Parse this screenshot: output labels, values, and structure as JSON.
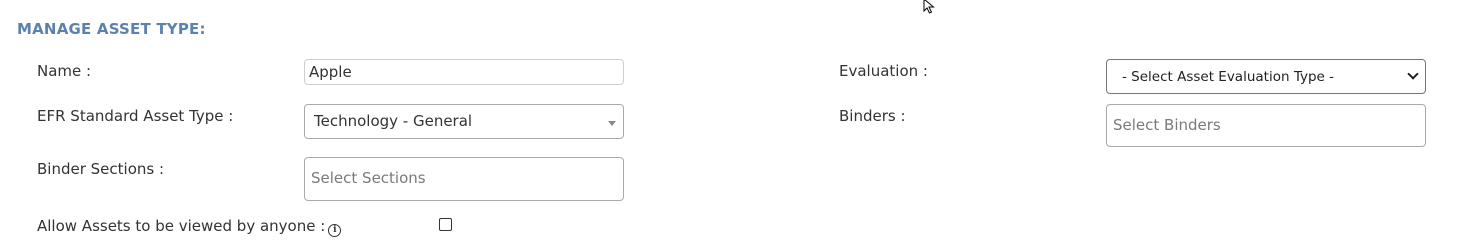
{
  "section": {
    "title": "MANAGE ASSET TYPE:"
  },
  "fields": {
    "name": {
      "label": "Name :",
      "value": "Apple"
    },
    "efr_standard_asset_type": {
      "label": "EFR Standard Asset Type :",
      "value": "Technology - General"
    },
    "binder_sections": {
      "label": "Binder Sections :",
      "placeholder": "Select Sections"
    },
    "allow_assets_viewed": {
      "label": "Allow Assets to be viewed by anyone :",
      "checked": false,
      "info_icon": "info-icon"
    },
    "evaluation": {
      "label": "Evaluation :",
      "value": "- Select Asset Evaluation Type -"
    },
    "binders": {
      "label": "Binders :",
      "placeholder": "Select Binders"
    }
  },
  "colors": {
    "section_title": "#5b82ad",
    "label_text": "#333333",
    "placeholder_text": "#7a7a7a",
    "input_border": "#aaaaaa"
  },
  "icons": {
    "cursor": "mouse-cursor-icon",
    "info": "info-icon",
    "caret": "caret-down-icon"
  }
}
